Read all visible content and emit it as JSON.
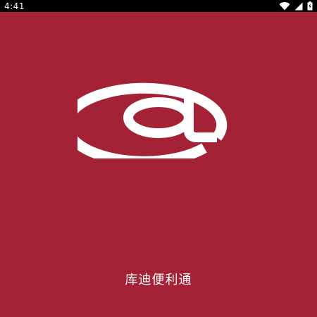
{
  "status_bar": {
    "time": "4:41",
    "icons": [
      "wifi-icon",
      "signal-icon",
      "battery-charging-icon"
    ]
  },
  "splash": {
    "logo_icon": "at-sign-icon",
    "app_name": "库迪便利通"
  },
  "colors": {
    "background": "#a32236",
    "status_bar": "#000000",
    "logo": "#ffffff",
    "text": "#ffffff"
  }
}
